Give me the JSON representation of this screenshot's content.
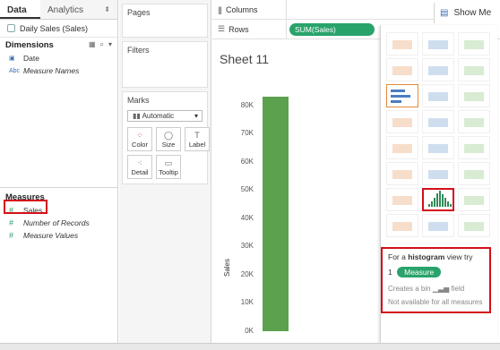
{
  "tabs": {
    "data": "Data",
    "analytics": "Analytics"
  },
  "datasource": "Daily Sales (Sales)",
  "dimensions": {
    "header": "Dimensions",
    "items": [
      {
        "type": "date",
        "label": "Date"
      },
      {
        "type": "abc",
        "label": "Measure Names"
      }
    ]
  },
  "measures": {
    "header": "Measures",
    "items": [
      {
        "label": "Sales"
      },
      {
        "label": "Number of Records"
      },
      {
        "label": "Measure Values"
      }
    ]
  },
  "shelves": {
    "pages": "Pages",
    "filters": "Filters",
    "marks": "Marks",
    "mark_type": "Automatic",
    "mark_buttons": [
      "Color",
      "Size",
      "Label",
      "Detail",
      "Tooltip"
    ],
    "columns": "Columns",
    "rows": "Rows",
    "rows_pill": "SUM(Sales)"
  },
  "sheet_title": "Sheet 11",
  "show_me": {
    "tab_label": "Show Me",
    "info_prefix": "For a",
    "info_keyword": "histogram",
    "info_suffix": "view try",
    "count": "1",
    "measure_pill": "Measure",
    "bin_prefix": "Creates a bin",
    "bin_suffix": "field",
    "not_available": "Not available for all measures"
  },
  "colors": {
    "bar": "#5ba14e",
    "pill": "#29a36a",
    "highlight": "#d3101a"
  },
  "chart_data": {
    "type": "bar",
    "categories": [
      ""
    ],
    "values": [
      83000
    ],
    "ylabel": "Sales",
    "ylim": [
      0,
      85000
    ],
    "yticks": [
      "80K",
      "70K",
      "60K",
      "50K",
      "40K",
      "30K",
      "20K",
      "10K",
      "0K"
    ]
  }
}
